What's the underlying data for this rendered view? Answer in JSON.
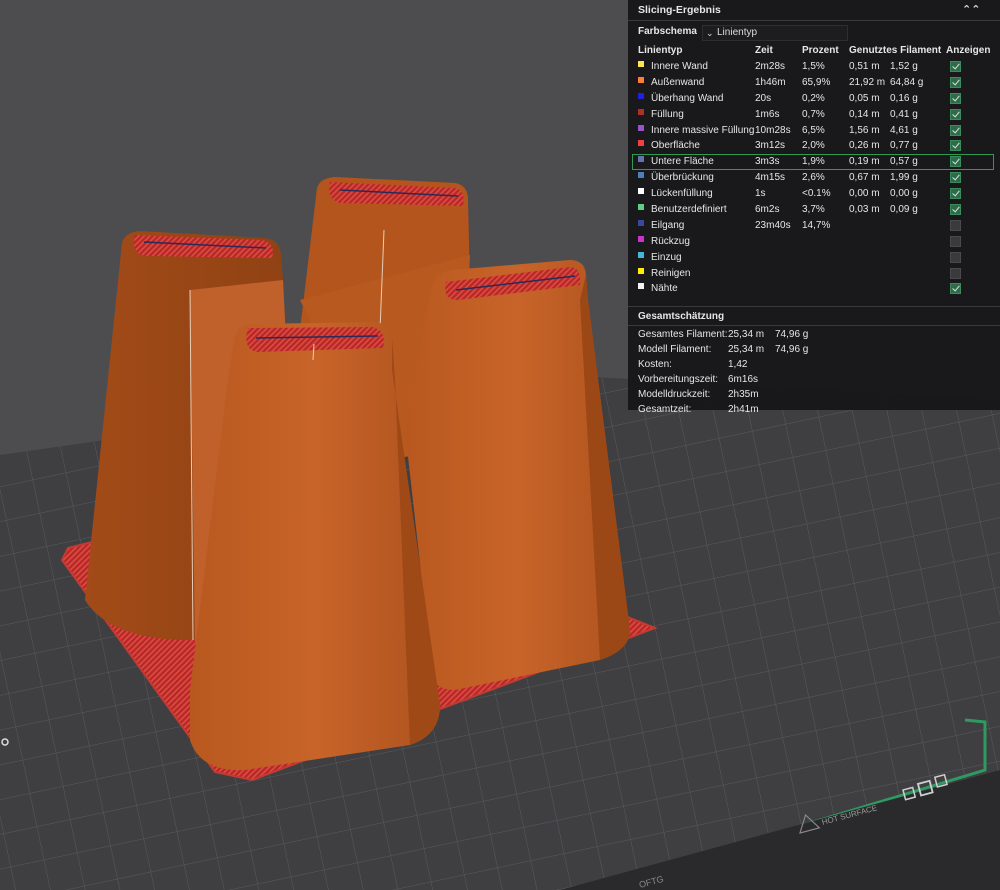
{
  "bed": {
    "brand_text": "HOT SURFACE",
    "corner_text": "OFTG"
  },
  "panel": {
    "title": "Slicing-Ergebnis",
    "color_scheme_label": "Farbschema",
    "color_scheme_value": "Linientyp",
    "columns": {
      "type": "Linientyp",
      "time": "Zeit",
      "percent": "Prozent",
      "filament": "Genutztes Filament",
      "show": "Anzeigen"
    },
    "rows": [
      {
        "name": "Innere Wand",
        "time": "2m28s",
        "percent": "1,5%",
        "meters": "0,51 m",
        "grams": "1,52 g",
        "color": "#ffe64d",
        "shown": true
      },
      {
        "name": "Außenwand",
        "time": "1h46m",
        "percent": "65,9%",
        "meters": "21,92 m",
        "grams": "64,84 g",
        "color": "#ff7d38",
        "shown": true
      },
      {
        "name": "Überhang Wand",
        "time": "20s",
        "percent": "0,2%",
        "meters": "0,05 m",
        "grams": "0,16 g",
        "color": "#1f1fe0",
        "shown": true
      },
      {
        "name": "Füllung",
        "time": "1m6s",
        "percent": "0,7%",
        "meters": "0,14 m",
        "grams": "0,41 g",
        "color": "#b03029",
        "shown": true
      },
      {
        "name": "Innere massive Füllung",
        "time": "10m28s",
        "percent": "6,5%",
        "meters": "1,56 m",
        "grams": "4,61 g",
        "color": "#9654cc",
        "shown": true
      },
      {
        "name": "Oberfläche",
        "time": "3m12s",
        "percent": "2,0%",
        "meters": "0,26 m",
        "grams": "0,77 g",
        "color": "#f04040",
        "shown": true
      },
      {
        "name": "Untere Fläche",
        "time": "3m3s",
        "percent": "1,9%",
        "meters": "0,19 m",
        "grams": "0,57 g",
        "color": "#6672ab",
        "shown": true,
        "highlighted": true
      },
      {
        "name": "Überbrückung",
        "time": "4m15s",
        "percent": "2,6%",
        "meters": "0,67 m",
        "grams": "1,99 g",
        "color": "#4d80ba",
        "shown": true
      },
      {
        "name": "Lückenfüllung",
        "time": "1s",
        "percent": "<0.1%",
        "meters": "0,00 m",
        "grams": "0,00 g",
        "color": "#ffffff",
        "shown": true
      },
      {
        "name": "Benutzerdefiniert",
        "time": "6m2s",
        "percent": "3,7%",
        "meters": "0,03 m",
        "grams": "0,09 g",
        "color": "#5ece85",
        "shown": true
      },
      {
        "name": "Eilgang",
        "time": "23m40s",
        "percent": "14,7%",
        "meters": "",
        "grams": "",
        "color": "#38489e",
        "shown": false
      },
      {
        "name": "Rückzug",
        "time": "",
        "percent": "",
        "meters": "",
        "grams": "",
        "color": "#cc33cc",
        "shown": false
      },
      {
        "name": "Einzug",
        "time": "",
        "percent": "",
        "meters": "",
        "grams": "",
        "color": "#40b8d6",
        "shown": false
      },
      {
        "name": "Reinigen",
        "time": "",
        "percent": "",
        "meters": "",
        "grams": "",
        "color": "#ffee00",
        "shown": false
      },
      {
        "name": "Nähte",
        "time": "",
        "percent": "",
        "meters": "",
        "grams": "",
        "color": "#f2f2f2",
        "shown": true
      }
    ],
    "estimate_title": "Gesamtschätzung",
    "estimates": [
      {
        "label": "Gesamtes Filament:",
        "m": "25,34 m",
        "g": "74,96 g"
      },
      {
        "label": "Modell Filament:",
        "m": "25,34 m",
        "g": "74,96 g"
      },
      {
        "label": "Kosten:",
        "m": "1,42",
        "g": ""
      },
      {
        "label": "Vorbereitungszeit:",
        "m": "6m16s",
        "g": ""
      },
      {
        "label": "Modelldruckzeit:",
        "m": "2h35m",
        "g": ""
      },
      {
        "label": "Gesamtzeit:",
        "m": "2h41m",
        "g": ""
      }
    ]
  }
}
